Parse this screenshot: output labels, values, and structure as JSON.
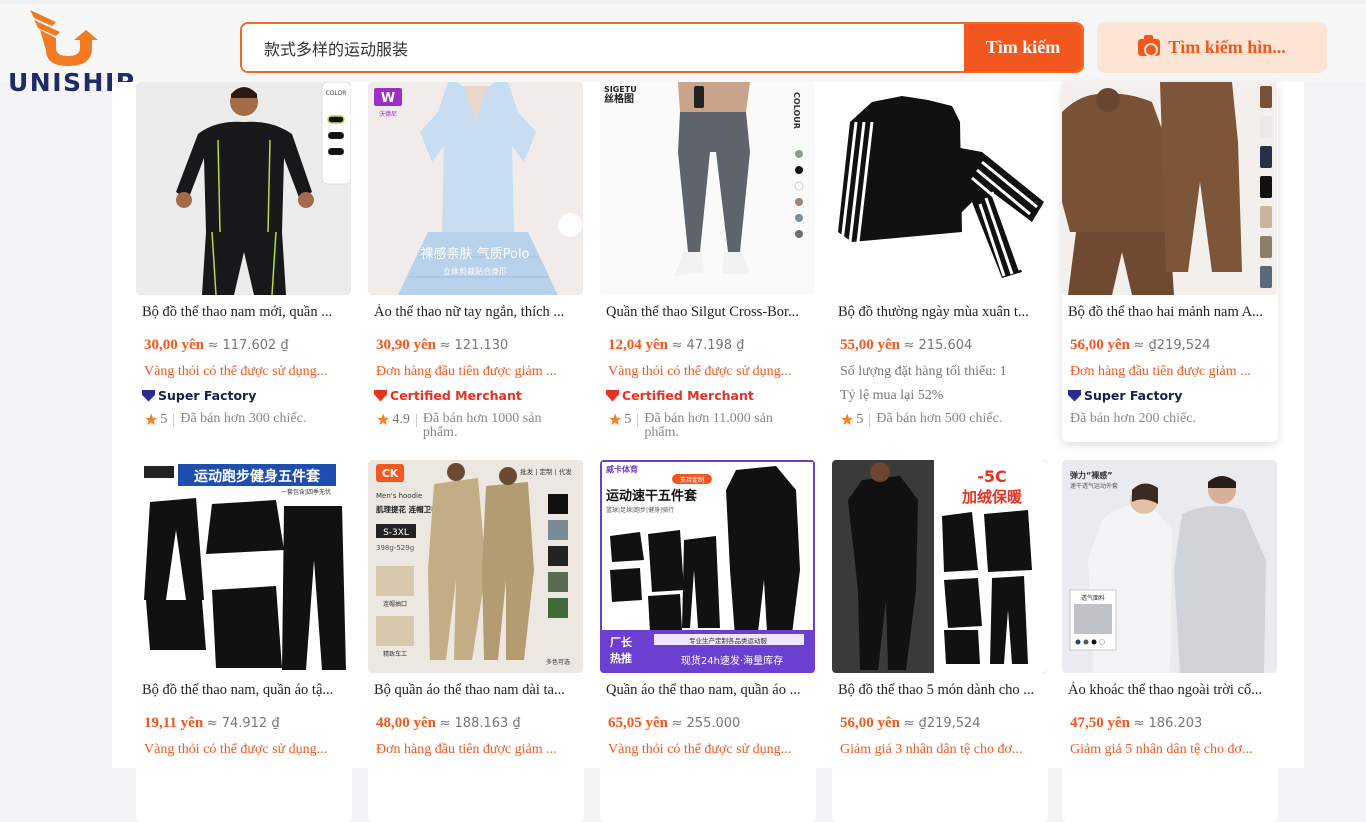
{
  "brand": {
    "name": "UNISHIP"
  },
  "search": {
    "value": "款式多样的运动服装",
    "button_label": "Tìm kiếm",
    "image_search_label": "Tìm kiếm hìn..."
  },
  "products": [
    {
      "title": "Bộ đồ thể thao nam mới, quần ...",
      "price": "30,00 yên",
      "approx": "≈ 117.602 ₫",
      "promo": "Vàng thỏi có thể được sử dụng...",
      "badge": "Super Factory",
      "rating": "5",
      "sold": "Đã bán hơn 300 chiếc."
    },
    {
      "title": "Áo thể thao nữ tay ngắn, thích ...",
      "price": "30,90 yên",
      "approx": "≈ 121.130",
      "promo": "Đơn hàng đầu tiên được giảm ...",
      "badge": "Certified Merchant",
      "rating": "4.9",
      "sold": "Đã bán hơn 1000 sản phẩm."
    },
    {
      "title": "Quần thể thao Silgut Cross-Bor...",
      "price": "12,04 yên",
      "approx": "≈ 47.198 ₫",
      "promo": "Vàng thỏi có thể được sử dụng...",
      "badge": "Certified Merchant",
      "rating": "5",
      "sold": "Đã bán hơn 11.000 sản phẩm."
    },
    {
      "title": "Bộ đồ thường ngày mùa xuân t...",
      "price": "55,00 yên",
      "approx": "≈ 215.604",
      "promo": "Số lượng đặt hàng tối thiểu: 1",
      "promo2": "Tỷ lệ mua lại 52%",
      "rating": "5",
      "sold": "Đã bán hơn 500 chiếc."
    },
    {
      "title": "Bộ đồ thể thao hai mảnh nam A...",
      "price": "56,00 yên",
      "approx": "≈ ₫219,524",
      "promo": "Đơn hàng đầu tiên được giảm ...",
      "badge": "Super Factory",
      "sold": "Đã bán hơn 200 chiếc."
    },
    {
      "title": "Bộ đồ thể thao nam, quần áo tậ...",
      "price": "19,11 yên",
      "approx": "≈ 74.912 ₫",
      "promo": "Vàng thỏi có thể được sử dụng..."
    },
    {
      "title": "Bộ quần áo thể thao nam dài ta...",
      "price": "48,00 yên",
      "approx": "≈ 188.163 ₫",
      "promo": "Đơn hàng đầu tiên được giảm ..."
    },
    {
      "title": "Quần áo thể thao nam, quần áo ...",
      "price": "65,05 yên",
      "approx": "≈ 255.000",
      "promo": "Vàng thỏi có thể được sử dụng..."
    },
    {
      "title": "Bộ đồ thể thao 5 món dành cho ...",
      "price": "56,00 yên",
      "approx": "≈ ₫219,524",
      "promo": "Giảm giá 3 nhân dân tệ cho đơ..."
    },
    {
      "title": "Áo khoác thể thao ngoài trời cổ...",
      "price": "47,50 yên",
      "approx": "≈ 186.203",
      "promo": "Giảm giá 5 nhân dân tệ cho đơ..."
    }
  ],
  "images": {
    "p1": {
      "color_label": "COLOR"
    },
    "p2": {
      "brand_text": "沃德尼",
      "overlay": "裸感亲肤 气质Polo",
      "overlay_sub": "立体剪裁贴合身形"
    },
    "p3": {
      "brand_text": "丝格图",
      "brand_en": "SIGETU",
      "color_label": "COLOUR"
    },
    "p6": {
      "headline": "运动跑步健身五件套",
      "sub": "一套包含|四季无忧"
    },
    "p7": {
      "tag": "Men's hoodie",
      "title": "肌理提花 连帽卫衣套装",
      "size": "S-3XL",
      "weight": "398g-529g",
      "top_right": "批发 | 定制 | 代发",
      "d1": "连帽抽口",
      "d2": "精致车工",
      "bottom": "多色可选"
    },
    "p8": {
      "brand": "威卡体育",
      "badge": "支持定制",
      "headline": "运动速干五件套",
      "sub": "篮球|足球|跑步|健身|骑行",
      "promo_a": "厂长",
      "promo_b": "热推",
      "promo_line1": "专业生产定制各品类运动服",
      "promo_line2": "现货24h速发·海量库存"
    },
    "p9": {
      "temp": "-5C",
      "headline": "加绒保暖"
    },
    "p10": {
      "headline": "弹力“裸感”",
      "sub": "速干透气运动外套",
      "swatch_label": "透气面料"
    }
  }
}
